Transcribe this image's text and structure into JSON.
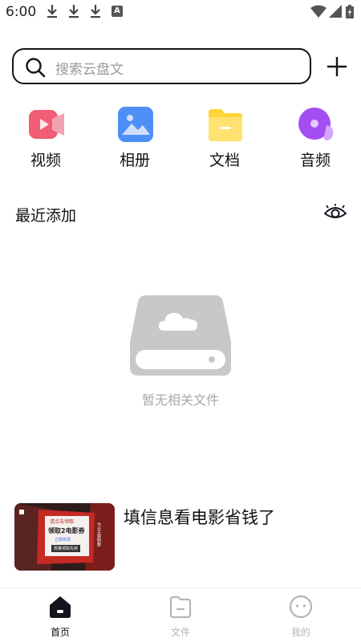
{
  "status_bar": {
    "time": "6:00",
    "notification_icons": [
      "download-icon",
      "download-icon",
      "download-icon",
      "a-icon"
    ],
    "a_icon_text": "A",
    "system_icons": [
      "wifi-icon",
      "signal-icon",
      "battery-icon"
    ]
  },
  "search": {
    "placeholder": "搜索云盘文"
  },
  "categories": [
    {
      "label": "视频",
      "icon": "video-icon",
      "color": "#f15d74"
    },
    {
      "label": "相册",
      "icon": "photo-icon",
      "color": "#4e8ef7"
    },
    {
      "label": "文档",
      "icon": "folder-icon",
      "color": "#ffd43b"
    },
    {
      "label": "音频",
      "icon": "music-icon",
      "color": "#a34df2"
    }
  ],
  "recent": {
    "title": "最近添加"
  },
  "empty_state": {
    "text": "暂无相关文件"
  },
  "ad": {
    "title": "填信息看电影省钱了",
    "thumb_text": {
      "header": "请点击领取",
      "line1": "领取2电影券",
      "line2": "立即抢票",
      "button": "限量领取先到",
      "side": "今日无限制数"
    }
  },
  "bottom_nav": [
    {
      "label": "首页",
      "icon": "home-icon",
      "active": true
    },
    {
      "label": "文件",
      "icon": "file-icon",
      "active": false
    },
    {
      "label": "我的",
      "icon": "profile-icon",
      "active": false
    }
  ],
  "colors": {
    "text_primary": "#111111",
    "text_placeholder": "#9a9a9a",
    "empty_icon": "#c8c8c8",
    "nav_inactive": "#b5b5b5"
  }
}
